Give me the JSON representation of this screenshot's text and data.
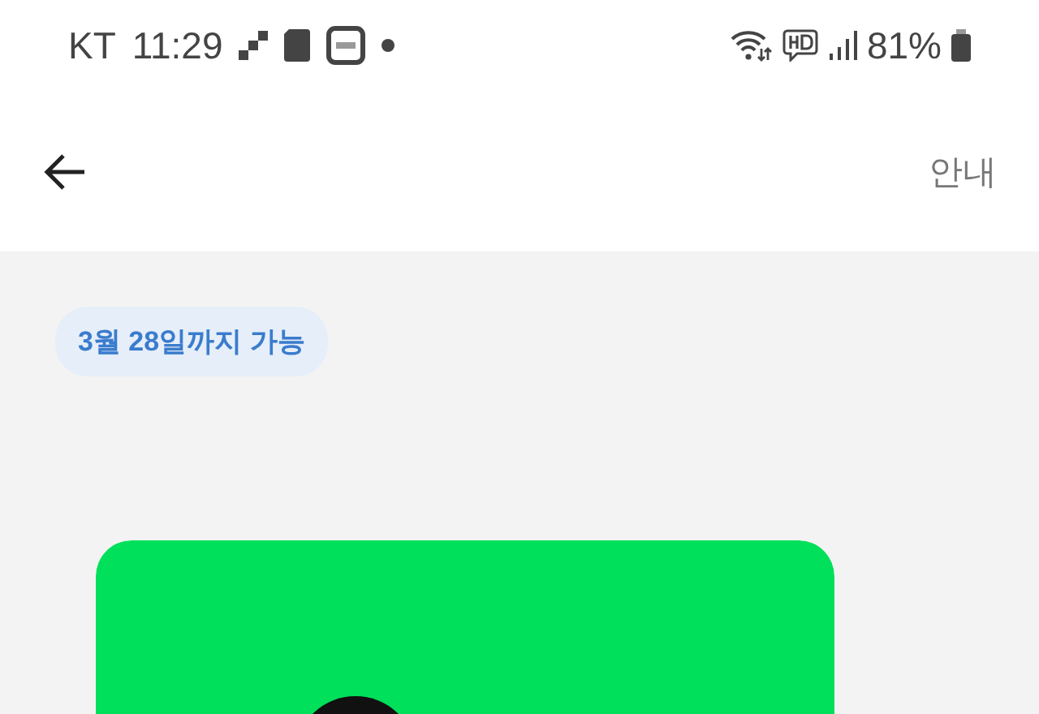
{
  "status_bar": {
    "carrier": "KT",
    "time": "11:29",
    "battery": "81%"
  },
  "app_bar": {
    "action": "안내"
  },
  "badge": {
    "label": "3월 28일까지 가능"
  }
}
